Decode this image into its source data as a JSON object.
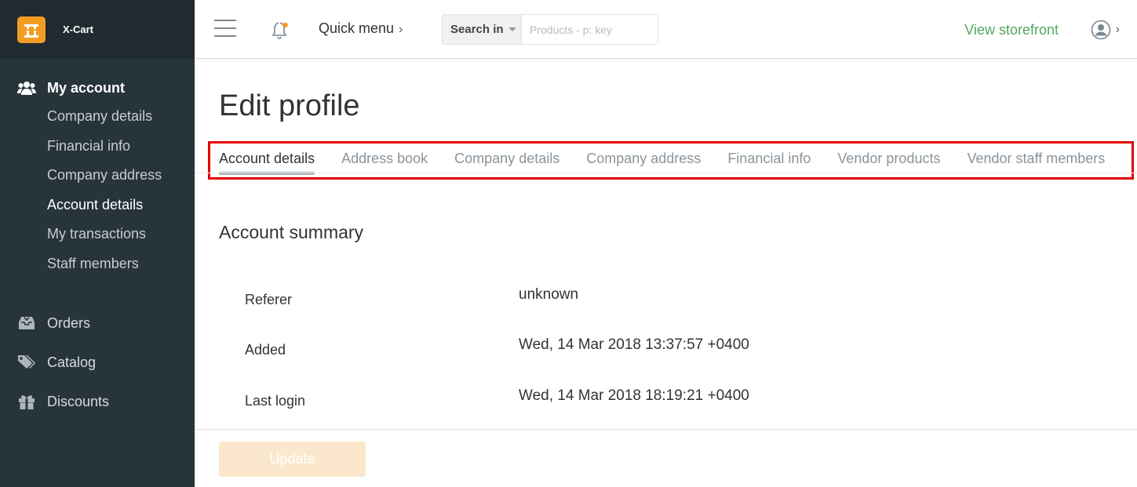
{
  "app": {
    "brand": "X-Cart"
  },
  "sidebar": {
    "account": {
      "label": "My account",
      "items": [
        "Company details",
        "Financial info",
        "Company address",
        "Account details",
        "My transactions",
        "Staff members"
      ]
    },
    "orders": "Orders",
    "catalog": "Catalog",
    "discounts": "Discounts"
  },
  "topbar": {
    "quick_menu": "Quick menu",
    "search_in": "Search in",
    "search_placeholder": "Products - p: key",
    "view_storefront": "View storefront"
  },
  "page": {
    "title": "Edit profile",
    "tabs": [
      "Account details",
      "Address book",
      "Company details",
      "Company address",
      "Financial info",
      "Vendor products",
      "Vendor staff members"
    ],
    "active_tab": "Account details"
  },
  "summary": {
    "title": "Account summary",
    "rows": [
      {
        "label": "Referer",
        "value": "unknown"
      },
      {
        "label": "Added",
        "value": "Wed, 14 Mar 2018 13:37:57 +0400"
      },
      {
        "label": "Last login",
        "value": "Wed, 14 Mar 2018 18:19:21 +0400"
      }
    ]
  },
  "actions": {
    "update": "Update"
  },
  "colors": {
    "sidebar": "#28343c",
    "accent": "#f39c23",
    "storefront_link": "#53a55e",
    "highlight_box": "#e20000"
  }
}
